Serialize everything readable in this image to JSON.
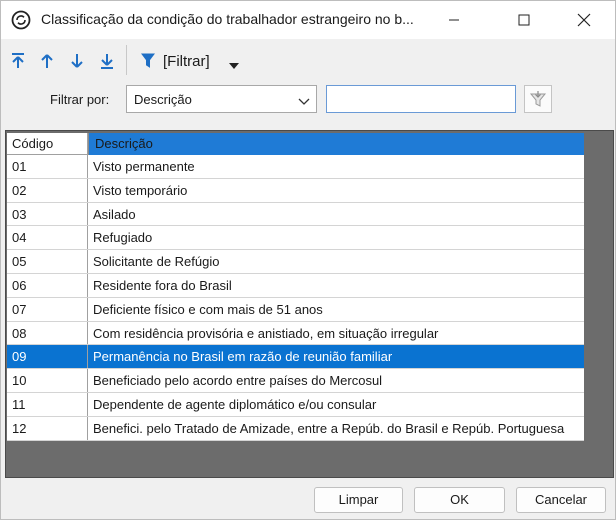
{
  "window": {
    "title": "Classificação da condição do trabalhador estrangeiro no b...",
    "icon": "app-logo-icon"
  },
  "toolbar": {
    "first_icon": "arrow-to-top-icon",
    "up_icon": "arrow-up-icon",
    "down_icon": "arrow-down-icon",
    "last_icon": "arrow-to-bottom-icon",
    "filter_icon": "funnel-icon",
    "filter_label": "[Filtrar]",
    "accent": "#1f6fc5"
  },
  "filter": {
    "label": "Filtrar por:",
    "field_value": "Descrição",
    "text_value": ""
  },
  "grid": {
    "columns": [
      "Código",
      "Descrição"
    ],
    "selected_index": 8,
    "selected_color": "#0a73d1",
    "rows": [
      {
        "code": "01",
        "desc": "Visto permanente"
      },
      {
        "code": "02",
        "desc": "Visto temporário"
      },
      {
        "code": "03",
        "desc": "Asilado"
      },
      {
        "code": "04",
        "desc": "Refugiado"
      },
      {
        "code": "05",
        "desc": "Solicitante de Refúgio"
      },
      {
        "code": "06",
        "desc": "Residente fora do Brasil"
      },
      {
        "code": "07",
        "desc": "Deficiente físico e com mais de 51 anos"
      },
      {
        "code": "08",
        "desc": "Com residência provisória e anistiado, em situação irregular"
      },
      {
        "code": "09",
        "desc": "Permanência no Brasil em razão de reunião familiar"
      },
      {
        "code": "10",
        "desc": "Beneficiado pelo acordo entre países do Mercosul"
      },
      {
        "code": "11",
        "desc": "Dependente de agente diplomático e/ou consular"
      },
      {
        "code": "12",
        "desc": "Benefici. pelo Tratado de Amizade, entre a Repúb. do Brasil e Repúb. Portuguesa"
      }
    ]
  },
  "buttons": {
    "clear": "Limpar",
    "ok": "OK",
    "cancel": "Cancelar"
  }
}
